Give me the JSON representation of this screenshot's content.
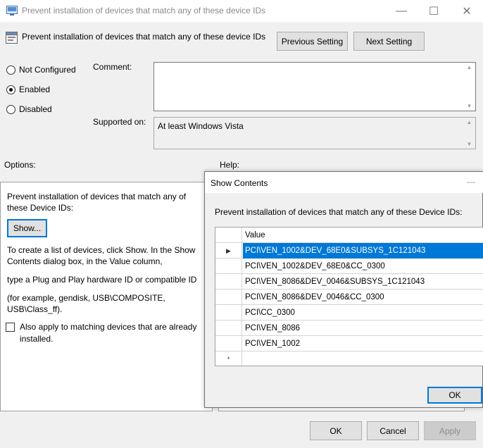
{
  "window": {
    "title": "Prevent installation of devices that match any of these device IDs",
    "minimize_glyph": "—",
    "maximize_glyph": "☐",
    "close_glyph": "✕"
  },
  "header": {
    "setting_title": "Prevent installation of devices that match  any of these device IDs",
    "previous_setting": "Previous Setting",
    "next_setting": "Next Setting"
  },
  "state": {
    "options": [
      "Not Configured",
      "Enabled",
      "Disabled"
    ],
    "selected": "Enabled"
  },
  "comment": {
    "label": "Comment:",
    "value": ""
  },
  "supported": {
    "label": "Supported on:",
    "value": "At least Windows Vista"
  },
  "sections": {
    "options_label": "Options:",
    "help_label": "Help:"
  },
  "options_panel": {
    "description_line1": "Prevent installation of devices that match any of",
    "description_line2": "these Device IDs:",
    "show_button": "Show...",
    "instructions_line1": "To create a list of devices, click Show. In the Show",
    "instructions_line2": "Contents dialog box, in the Value column,",
    "instructions_line3": "type a Plug and Play hardware ID or compatible ID",
    "instructions_line4": "(for example, gendisk, USB\\COMPOSITE,",
    "instructions_line5": "USB\\Class_ff).",
    "also_apply_line1": "Also apply to matching devices that are already",
    "also_apply_line2": "installed."
  },
  "show_contents": {
    "title": "Show Contents",
    "title_minimize": "—",
    "prompt": "Prevent installation of devices that match any of these Device IDs:",
    "column_header": "Value",
    "current_row_marker": "▶",
    "new_row_marker": "*",
    "values": [
      "PCI\\VEN_1002&DEV_68E0&SUBSYS_1C121043",
      "PCI\\VEN_1002&DEV_68E0&CC_0300",
      "PCI\\VEN_8086&DEV_0046&SUBSYS_1C121043",
      "PCI\\VEN_8086&DEV_0046&CC_0300",
      "PCI\\CC_0300",
      "PCI\\VEN_8086",
      "PCI\\VEN_1002"
    ],
    "ok": "OK"
  },
  "footer": {
    "ok": "OK",
    "cancel": "Cancel",
    "apply": "Apply"
  },
  "colors": {
    "accent": "#0078d7",
    "selection": "#0078d7",
    "disabled_text": "#8c8c8c"
  }
}
